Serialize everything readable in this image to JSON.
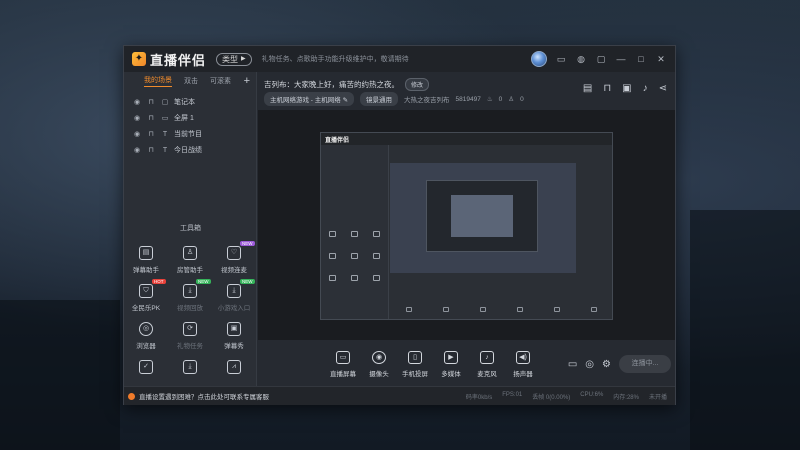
{
  "app": {
    "logo_text": "直播伴侣",
    "version_label": "类型",
    "notice": "礼物任务、点歌助手功能升级维护中，敬请期待"
  },
  "left_panel": {
    "tabs": [
      "我的场景",
      "双击",
      "可滚素"
    ],
    "add_label": "+",
    "scenes": [
      {
        "label": "笔记本"
      },
      {
        "label": "全屏 1"
      },
      {
        "label": "当前节目"
      },
      {
        "label": "今日战绩"
      }
    ],
    "toolbox_title": "工具箱",
    "tools": [
      {
        "label": "弹幕助手",
        "icon": "danmaku-helper-icon",
        "glyph": "▤",
        "tag": "",
        "dim": false
      },
      {
        "label": "房管助手",
        "icon": "room-manager-icon",
        "glyph": "♙",
        "tag": "",
        "dim": false
      },
      {
        "label": "视频连麦",
        "icon": "video-link-icon",
        "glyph": "♡",
        "tag": "NEW",
        "dim": false
      },
      {
        "label": "全民乐PK",
        "icon": "pk-shield-icon",
        "glyph": "⛉",
        "tag": "HOT",
        "dim": false
      },
      {
        "label": "视频回放",
        "icon": "video-replay-icon",
        "glyph": "⤓",
        "tag": "NEW",
        "dim": true
      },
      {
        "label": "小游戏入口",
        "icon": "mini-game-icon",
        "glyph": "⤓",
        "tag": "NEW",
        "dim": true
      },
      {
        "label": "浏览器",
        "icon": "browser-icon",
        "glyph": "◎",
        "tag": "",
        "dim": false
      },
      {
        "label": "礼物任务",
        "icon": "gift-task-icon",
        "glyph": "⟳",
        "tag": "",
        "dim": true
      },
      {
        "label": "弹幕秀",
        "icon": "danmaku-show-icon",
        "glyph": "▣",
        "tag": "",
        "dim": false
      },
      {
        "label": "",
        "icon": "calendar-check-icon",
        "glyph": "✓",
        "tag": "",
        "dim": false
      },
      {
        "label": "",
        "icon": "download-icon",
        "glyph": "⤓",
        "tag": "",
        "dim": false
      },
      {
        "label": "",
        "icon": "signal-icon",
        "glyph": "⩘",
        "tag": "",
        "dim": false
      }
    ]
  },
  "infobar": {
    "title": "吉列布：大家晚上好，痛苦的约热之夜。",
    "edit_label": "修改",
    "chip1": "主机网络游戏 - 主机网络 ✎",
    "chip2": "镜景通用",
    "extra": "大热之夜吉列布",
    "room_id": "5819497",
    "likes": "0",
    "viewers": "0"
  },
  "bottombar": {
    "items": [
      {
        "label": "直播屏幕",
        "icon": "screen-capture-icon",
        "glyph": "▭"
      },
      {
        "label": "摄像头",
        "icon": "camera-icon",
        "glyph": "◉"
      },
      {
        "label": "手机投屏",
        "icon": "phone-cast-icon",
        "glyph": "▯"
      },
      {
        "label": "多媒体",
        "icon": "media-play-icon",
        "glyph": "▶"
      },
      {
        "label": "麦克风",
        "icon": "microphone-icon",
        "glyph": "♪"
      },
      {
        "label": "扬声器",
        "icon": "speaker-icon",
        "glyph": "◀)"
      }
    ],
    "live_button": "连播中..."
  },
  "statusbar": {
    "message": "直播设置遇到困难？点击此处可联系专属客服",
    "stats": [
      "码率0kb/s",
      "FPS:01",
      "丢帧 0(0.00%)",
      "CPU:6%",
      "内存:28%",
      "未开播"
    ]
  }
}
